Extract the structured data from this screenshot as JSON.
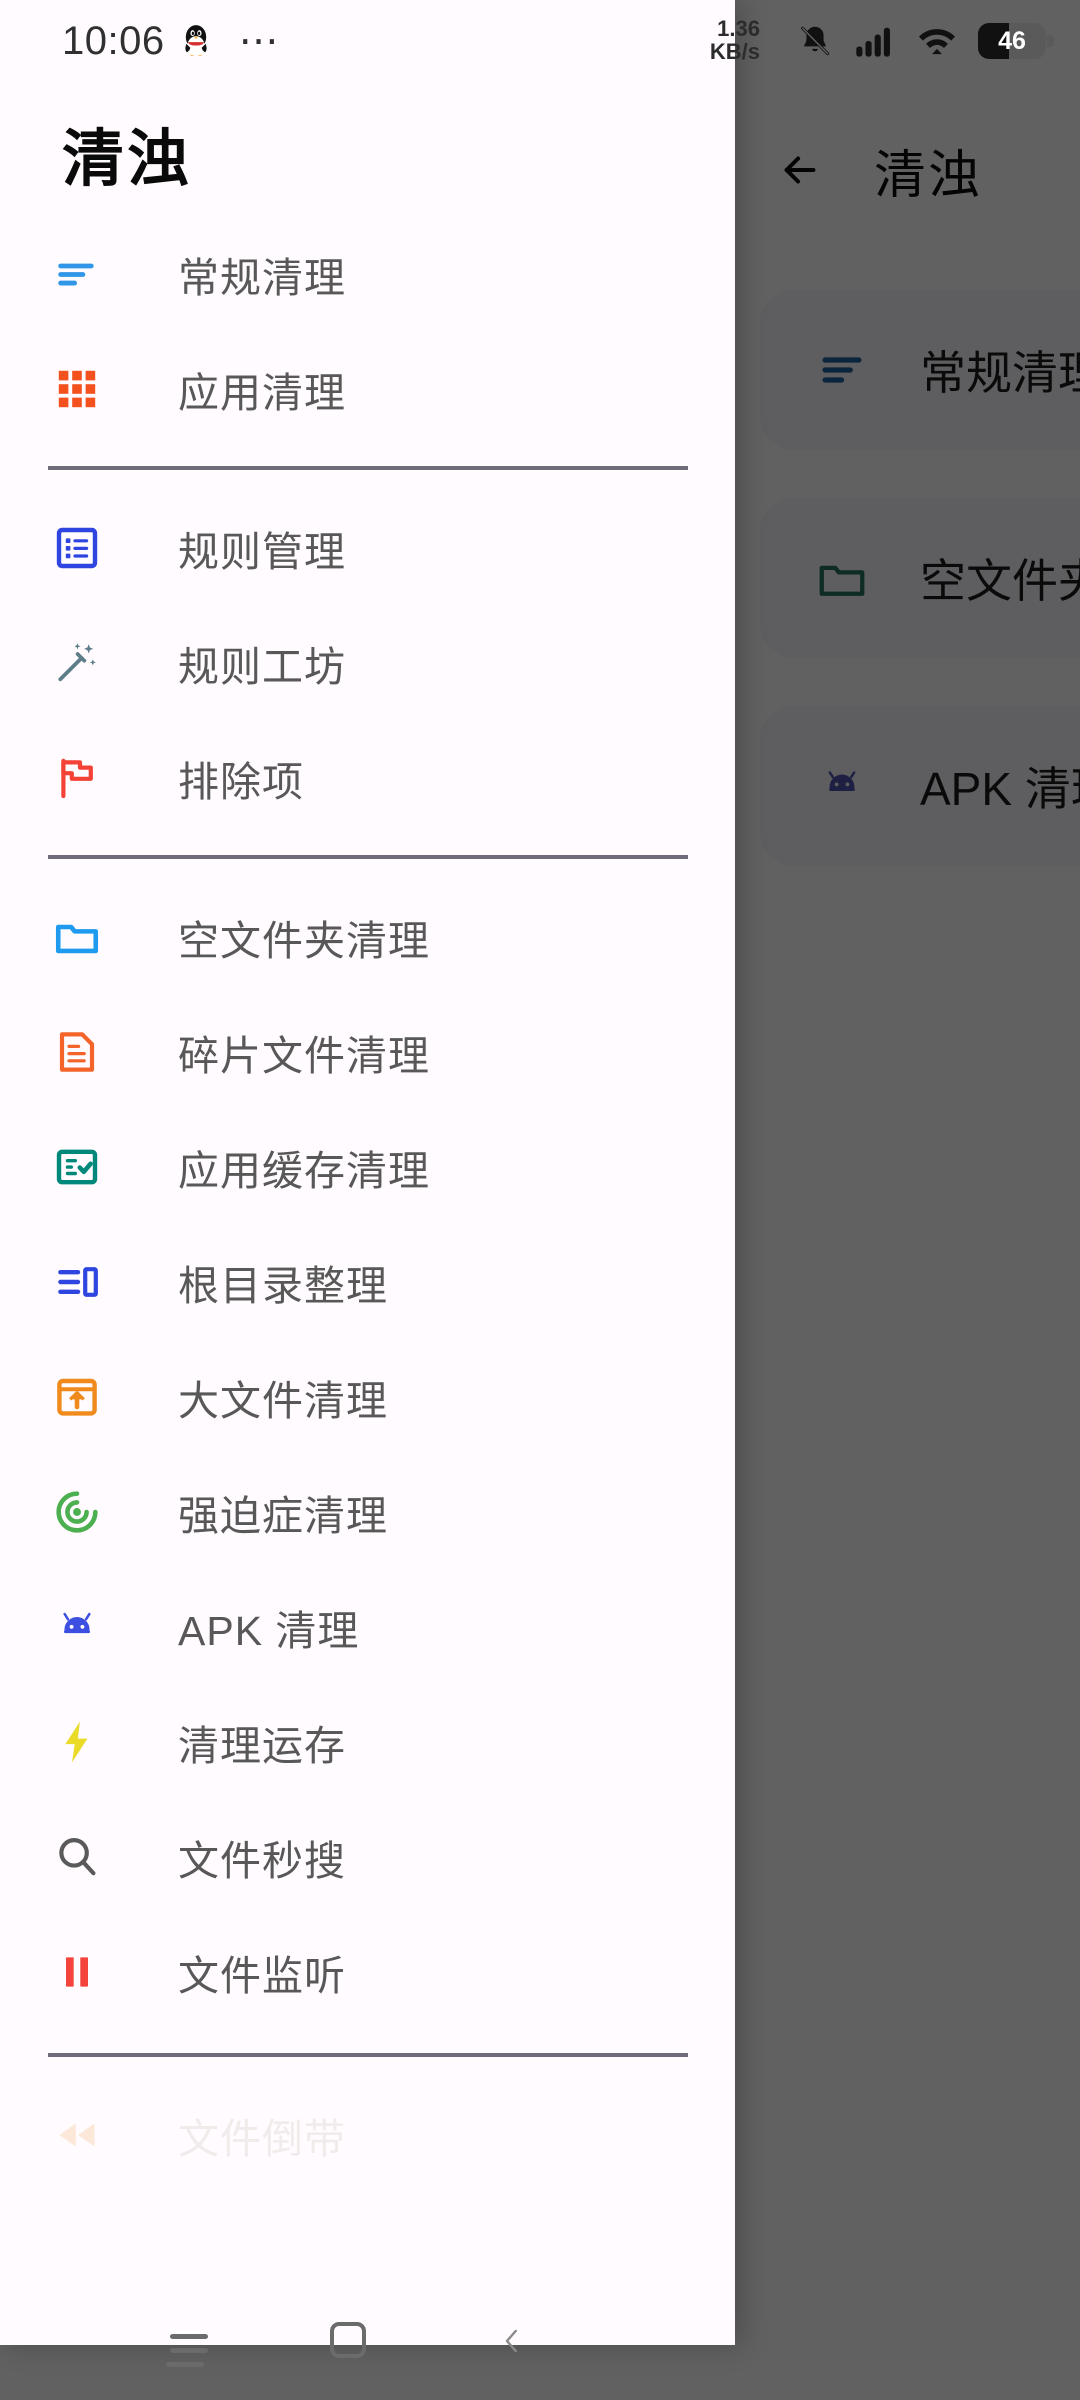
{
  "status_bar": {
    "time": "10:06",
    "notification_icon": "qq-penguin-icon",
    "overflow": "⋯",
    "net_speed_value": "1.36",
    "net_speed_unit": "KB/s",
    "icons": [
      "bell-mute-icon",
      "signal-bars-icon",
      "wifi-icon"
    ],
    "battery_level": "46"
  },
  "background_activity": {
    "back_label": "←",
    "title": "清浊",
    "cards": [
      {
        "label": "常规清理",
        "icon": "lines-decreasing-icon",
        "color": "#1a5c96"
      },
      {
        "label": "空文件夹清理",
        "icon": "folder-icon",
        "color": "#236b60"
      },
      {
        "label": "APK 清理",
        "icon": "android-icon",
        "color": "#4a51a8"
      }
    ]
  },
  "drawer": {
    "title": "清浊",
    "sections": [
      {
        "items": [
          {
            "label": "常规清理",
            "icon": "lines-decreasing-icon",
            "color": "#2f96e8"
          },
          {
            "label": "应用清理",
            "icon": "grid-dots-icon",
            "color": "#f4511e"
          }
        ]
      },
      {
        "items": [
          {
            "label": "规则管理",
            "icon": "list-box-icon",
            "color": "#2f45e0"
          },
          {
            "label": "规则工坊",
            "icon": "magic-wand-icon",
            "color": "#5d7d8a"
          },
          {
            "label": "排除项",
            "icon": "flag-icon",
            "color": "#f44336"
          }
        ]
      },
      {
        "items": [
          {
            "label": "空文件夹清理",
            "icon": "folder-icon",
            "color": "#1e9bef"
          },
          {
            "label": "碎片文件清理",
            "icon": "document-icon",
            "color": "#f4642a"
          },
          {
            "label": "应用缓存清理",
            "icon": "checklist-icon",
            "color": "#00897b"
          },
          {
            "label": "根目录整理",
            "icon": "root-list-icon",
            "color": "#2f45e0"
          },
          {
            "label": "大文件清理",
            "icon": "box-upload-icon",
            "color": "#f08a1c"
          },
          {
            "label": "强迫症清理",
            "icon": "radar-target-icon",
            "color": "#4caf50"
          },
          {
            "label": "APK 清理",
            "icon": "android-icon",
            "color": "#3d4fe0"
          },
          {
            "label": "清理运存",
            "icon": "lightning-icon",
            "color": "#eadb28"
          },
          {
            "label": "文件秒搜",
            "icon": "search-icon",
            "color": "#5a5a5a"
          },
          {
            "label": "文件监听",
            "icon": "pause-bars-icon",
            "color": "#f4433a"
          }
        ]
      },
      {
        "faded": true,
        "items": [
          {
            "label": "文件倒带",
            "icon": "rewind-icon",
            "color": "#f08a1c"
          }
        ]
      }
    ]
  },
  "nav_bar": {
    "recents_label": "recents-icon",
    "home_label": "home-icon",
    "back_label": "back-icon"
  },
  "colors": {
    "drawer_bg": "#fffbfe",
    "scrim": "rgba(0,0,0,0.60)",
    "label_text": "#585858",
    "divider": "#706c7a"
  }
}
